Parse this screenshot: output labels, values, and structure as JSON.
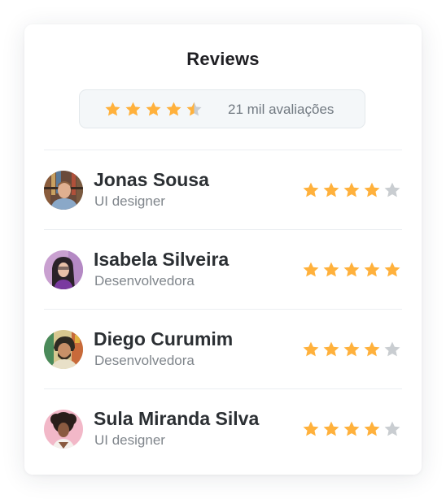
{
  "header": {
    "title": "Reviews"
  },
  "summary": {
    "rating_stars": 4.5,
    "count_text": "21 mil avaliações"
  },
  "colors": {
    "star_filled": "#ffb13c",
    "star_empty": "#c9cdd1"
  },
  "reviews": [
    {
      "name": "Jonas Sousa",
      "role": "UI designer",
      "rating": 4,
      "avatar": "avatar-photo-icon"
    },
    {
      "name": "Isabela Silveira",
      "role": "Desenvolvedora",
      "rating": 5,
      "avatar": "avatar-photo-icon"
    },
    {
      "name": "Diego Curumim",
      "role": "Desenvolvedora",
      "rating": 4,
      "avatar": "avatar-photo-icon"
    },
    {
      "name": "Sula Miranda Silva",
      "role": "UI designer",
      "rating": 4,
      "avatar": "avatar-photo-icon"
    }
  ]
}
